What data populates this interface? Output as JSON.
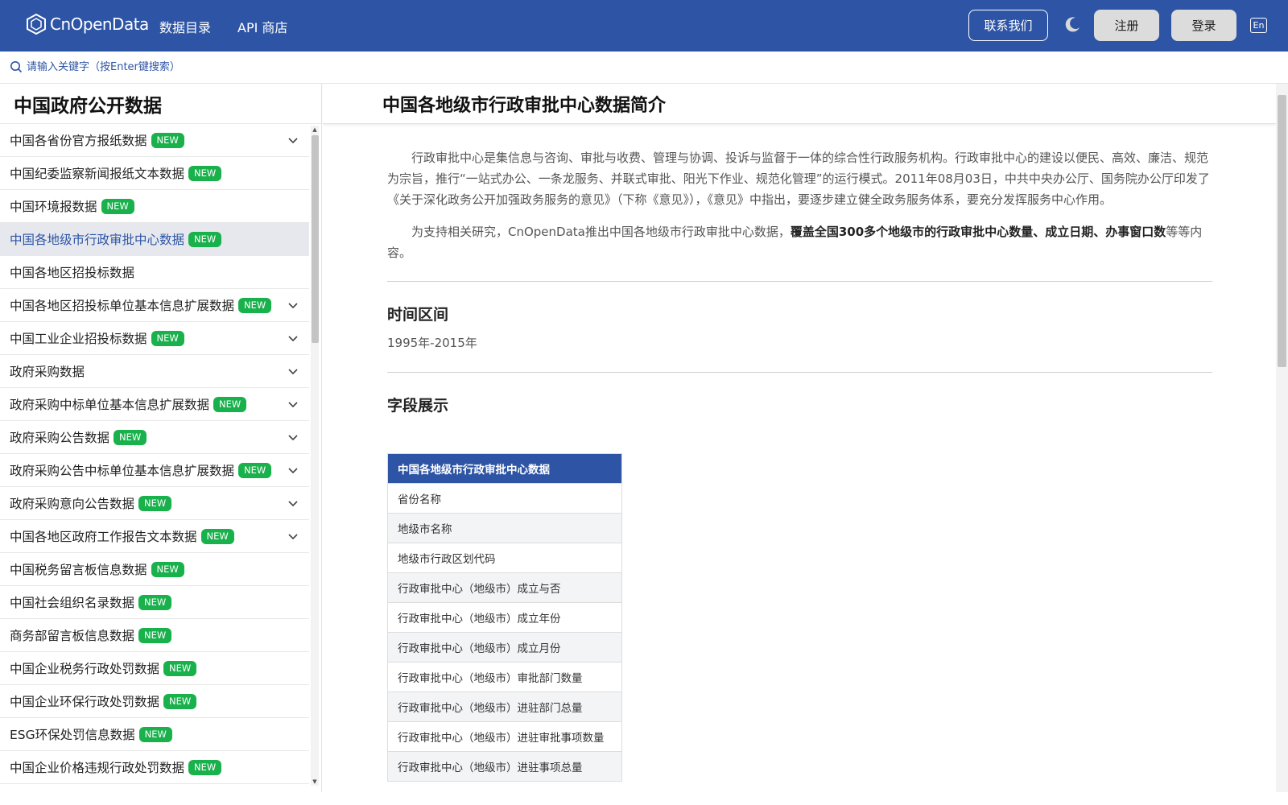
{
  "header": {
    "logo_text": "CnOpenData",
    "nav": [
      "数据目录",
      "API 商店"
    ],
    "contact_label": "联系我们",
    "register_label": "注册",
    "login_label": "登录",
    "lang_label": "En"
  },
  "search": {
    "placeholder": "请输入关键字（按Enter键搜索）"
  },
  "sidebar": {
    "title": "中国政府公开数据",
    "badge_text": "NEW",
    "items": [
      {
        "label": "中国各省份官方报纸数据",
        "new": true,
        "expand": true
      },
      {
        "label": "中国纪委监察新闻报纸文本数据",
        "new": true,
        "expand": false
      },
      {
        "label": "中国环境报数据",
        "new": true,
        "expand": false
      },
      {
        "label": "中国各地级市行政审批中心数据",
        "new": true,
        "expand": false,
        "active": true
      },
      {
        "label": "中国各地区招投标数据",
        "new": false,
        "expand": false
      },
      {
        "label": "中国各地区招投标单位基本信息扩展数据",
        "new": true,
        "expand": true
      },
      {
        "label": "中国工业企业招投标数据",
        "new": true,
        "expand": true
      },
      {
        "label": "政府采购数据",
        "new": false,
        "expand": true
      },
      {
        "label": "政府采购中标单位基本信息扩展数据",
        "new": true,
        "expand": true
      },
      {
        "label": "政府采购公告数据",
        "new": true,
        "expand": true
      },
      {
        "label": "政府采购公告中标单位基本信息扩展数据",
        "new": true,
        "expand": true
      },
      {
        "label": "政府采购意向公告数据",
        "new": true,
        "expand": true
      },
      {
        "label": "中国各地区政府工作报告文本数据",
        "new": true,
        "expand": true
      },
      {
        "label": "中国税务留言板信息数据",
        "new": true,
        "expand": false
      },
      {
        "label": "中国社会组织名录数据",
        "new": true,
        "expand": false
      },
      {
        "label": "商务部留言板信息数据",
        "new": true,
        "expand": false
      },
      {
        "label": "中国企业税务行政处罚数据",
        "new": true,
        "expand": false
      },
      {
        "label": "中国企业环保行政处罚数据",
        "new": true,
        "expand": false
      },
      {
        "label": "ESG环保处罚信息数据",
        "new": true,
        "expand": false
      },
      {
        "label": "中国企业价格违规行政处罚数据",
        "new": true,
        "expand": false
      }
    ]
  },
  "main": {
    "title": "中国各地级市行政审批中心数据简介",
    "intro_p1": "行政审批中心是集信息与咨询、审批与收费、管理与协调、投诉与监督于一体的综合性行政服务机构。行政审批中心的建设以便民、高效、廉洁、规范为宗旨，推行“一站式办公、一条龙服务、并联式审批、阳光下作业、规范化管理”的运行模式。2011年08月03日，中共中央办公厅、国务院办公厅印发了《关于深化政务公开加强政务服务的意见》（下称《意见》），《意见》中指出，要逐步建立健全政务服务体系，要充分发挥服务中心作用。",
    "intro_p2_pre": "为支持相关研究，CnOpenData推出中国各地级市行政审批中心数据，",
    "intro_p2_bold": "覆盖全国300多个地级市的行政审批中心数量、成立日期、办事窗口数",
    "intro_p2_post": "等等内容。",
    "time_title": "时间区间",
    "time_value": "1995年-2015年",
    "fields_title": "字段展示",
    "table_header": "中国各地级市行政审批中心数据",
    "fields": [
      "省份名称",
      "地级市名称",
      "地级市行政区划代码",
      "行政审批中心（地级市）成立与否",
      "行政审批中心（地级市）成立年份",
      "行政审批中心（地级市）成立月份",
      "行政审批中心（地级市）审批部门数量",
      "行政审批中心（地级市）进驻部门总量",
      "行政审批中心（地级市）进驻审批事项数量",
      "行政审批中心（地级市）进驻事项总量"
    ]
  }
}
